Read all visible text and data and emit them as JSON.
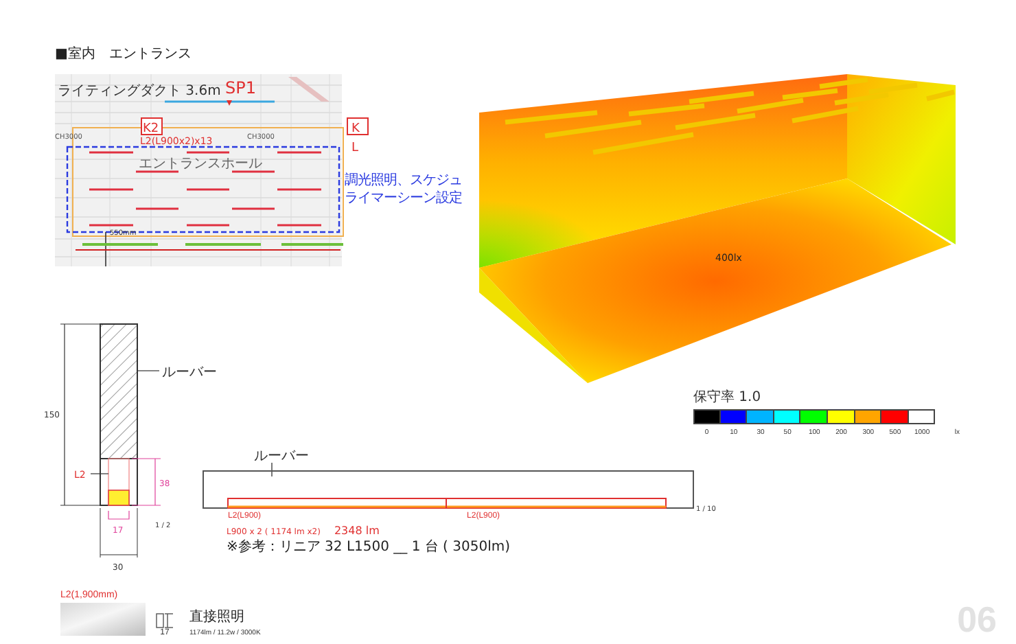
{
  "heading": "■室内　エントランス",
  "plan": {
    "duct_label": "ライティングダクト 3.6m",
    "spot_tag": "SP1",
    "zone_tags": [
      "K2",
      "K"
    ],
    "fixture_label": "L2(L900x2)x13",
    "ceiling_heights": [
      "CH3000",
      "CH3000"
    ],
    "room_name": "エントランスホール",
    "offset_dim": "550mm",
    "cut_letter": "L",
    "note_lines": [
      "調光照明、スケジュ",
      "ライマーシーン設定"
    ]
  },
  "render": {
    "floor_reading": "400lx"
  },
  "legend": {
    "title": "保守率 1.0",
    "unit": "lx",
    "bins": [
      {
        "label": "0",
        "color": "#000000"
      },
      {
        "label": "10",
        "color": "#0000ff"
      },
      {
        "label": "30",
        "color": "#00b4ff"
      },
      {
        "label": "50",
        "color": "#00ffff"
      },
      {
        "label": "100",
        "color": "#00ff00"
      },
      {
        "label": "200",
        "color": "#ffff00"
      },
      {
        "label": "300",
        "color": "#ffa500"
      },
      {
        "label": "500",
        "color": "#ff0000"
      },
      {
        "label": "1000",
        "color": "#ffffff"
      }
    ]
  },
  "section": {
    "height_dim": "150",
    "louver_label": "ルーバー",
    "fixture_tag": "L2",
    "fixture_height_dim": "38",
    "fixture_width_dim": "17",
    "width_dim": "30",
    "scale": "1 / 2"
  },
  "elevation": {
    "louver_label": "ルーバー",
    "segment_labels": [
      "L2(L900)",
      "L2(L900)"
    ],
    "output_formula": "L900 x 2 ( 1174 lm x2)",
    "output_total": "2348 lm",
    "reference_note": "※参考：リニア 32  L1500 __ 1 台 ( 3050lm)",
    "scale": "1 / 10"
  },
  "product": {
    "name": "L2(1,900mm)",
    "profile_dim": "17",
    "type": "直接照明",
    "spec": "1174lm / 11.2w / 3000K"
  },
  "page_number": "06"
}
